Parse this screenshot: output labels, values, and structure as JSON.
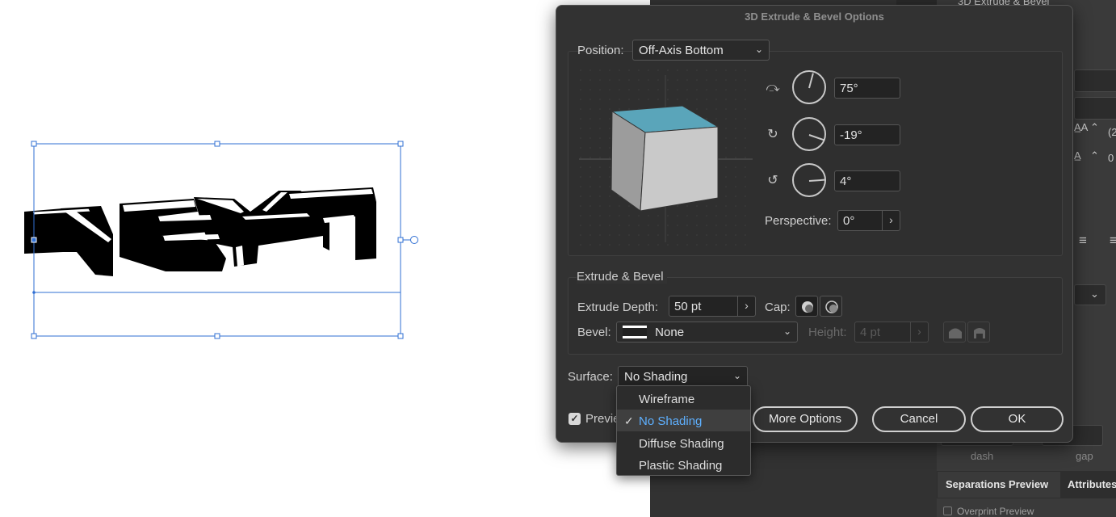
{
  "dialog": {
    "title": "3D Extrude & Bevel Options",
    "position_label": "Position:",
    "position_value": "Off-Axis Bottom",
    "x_rotation": "75°",
    "y_rotation": "-19°",
    "z_rotation": "4°",
    "perspective_label": "Perspective:",
    "perspective_value": "0°",
    "extrude_section_title": "Extrude & Bevel",
    "extrude_depth_label": "Extrude Depth:",
    "extrude_depth_value": "50 pt",
    "cap_label": "Cap:",
    "bevel_label": "Bevel:",
    "bevel_value": "None",
    "height_label": "Height:",
    "height_value": "4 pt",
    "surface_label": "Surface:",
    "surface_value": "No Shading",
    "preview_label": "Previe",
    "preview_checked": true,
    "more_options_label": "More Options",
    "cancel_label": "Cancel",
    "ok_label": "OK",
    "cube_top_color": "#5aa5ba",
    "cube_front_color": "#c9c9c9",
    "cube_side_color": "#9c9c9c"
  },
  "surface_menu": {
    "items": [
      {
        "label": "Wireframe",
        "selected": false
      },
      {
        "label": "No Shading",
        "selected": true
      },
      {
        "label": "Diffuse Shading",
        "selected": false
      },
      {
        "label": "Plastic Shading",
        "selected": false
      }
    ],
    "check_glyph": "✓"
  },
  "background_panel": {
    "effect_label": "3D Extrude & Bevel",
    "dash_label": "dash",
    "gap_label": "gap",
    "tabs": [
      "Separations Preview",
      "Attributes"
    ],
    "overprint_label": "Overprint Preview"
  },
  "artwork": {
    "text": "TEXT",
    "selection_color": "#2f6fd3"
  }
}
